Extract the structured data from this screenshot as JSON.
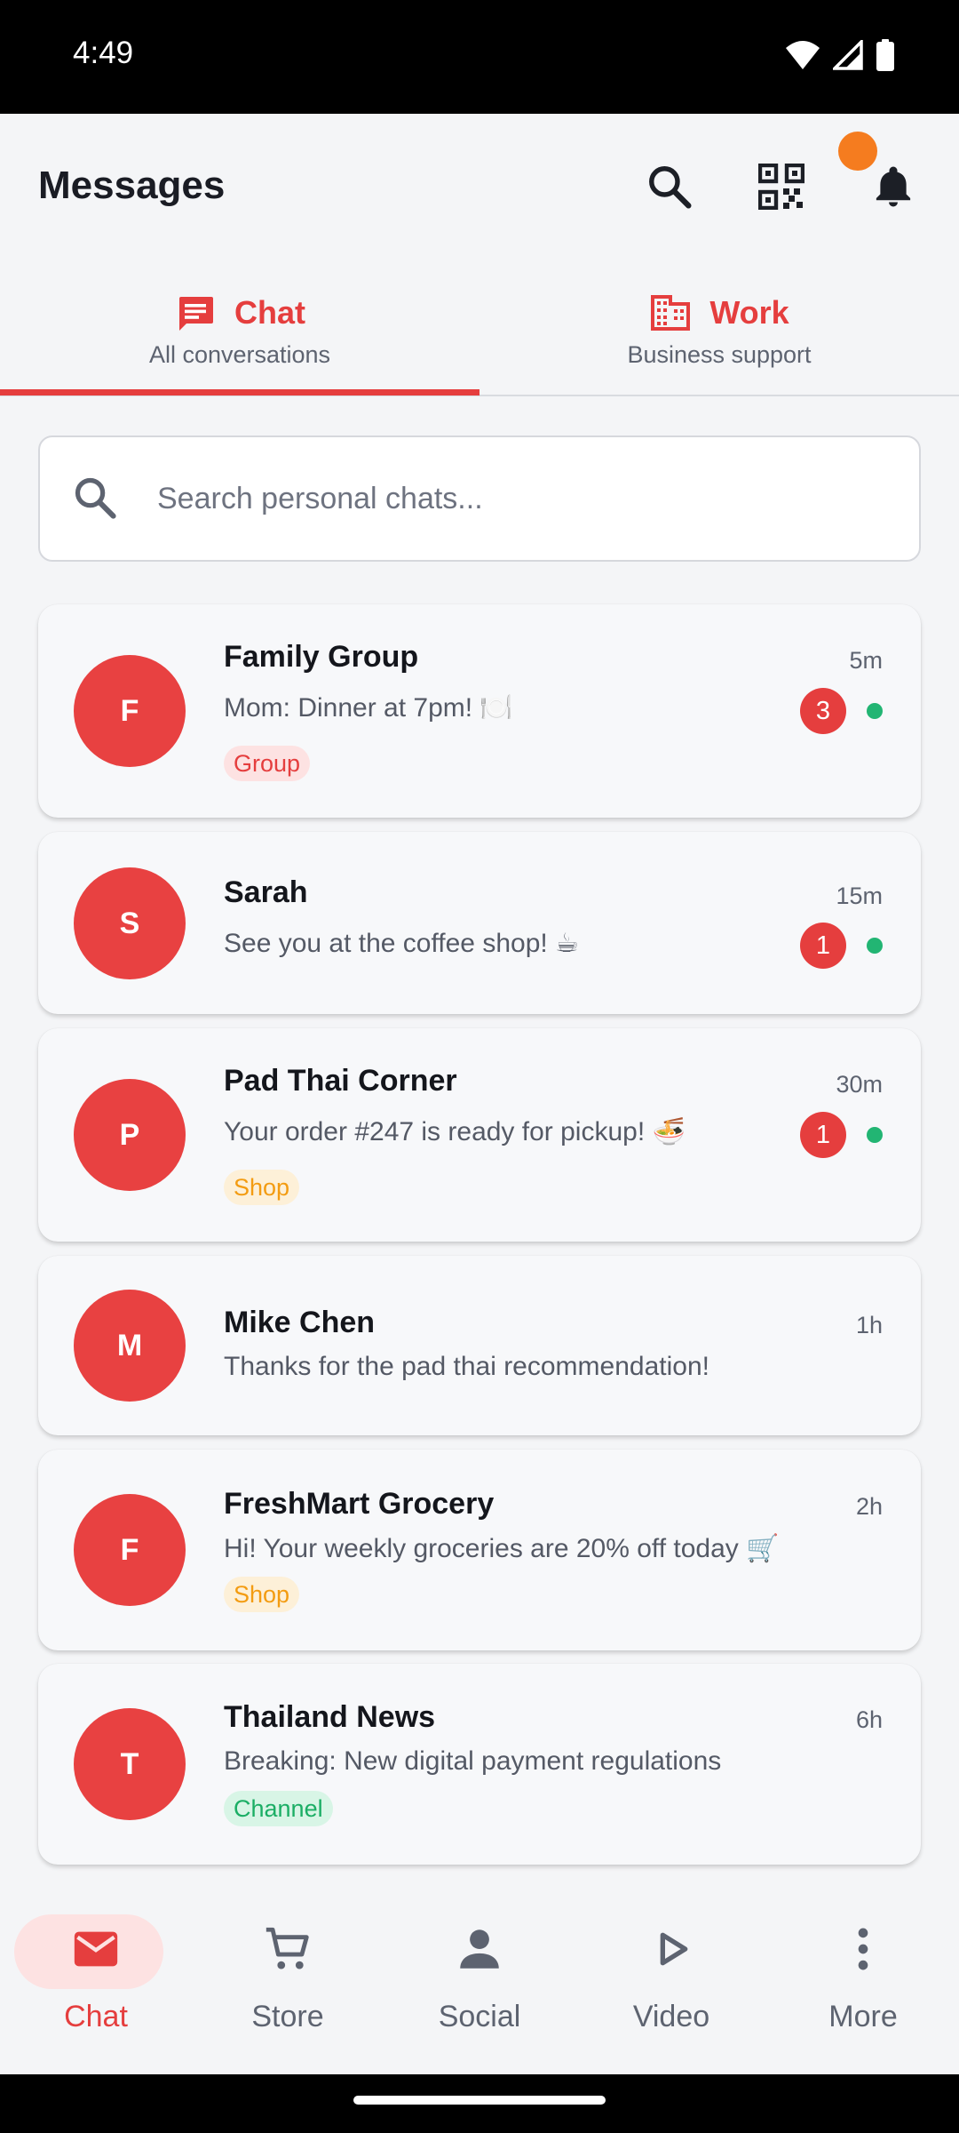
{
  "status_bar": {
    "time": "4:49"
  },
  "header": {
    "title": "Messages"
  },
  "tabs": [
    {
      "label": "Chat",
      "sub": "All conversations",
      "icon": "chat-icon"
    },
    {
      "label": "Work",
      "sub": "Business support",
      "icon": "building-icon"
    }
  ],
  "search": {
    "placeholder": "Search personal chats..."
  },
  "chats": [
    {
      "initial": "F",
      "name": "Family Group",
      "time": "5m",
      "message": "Mom: Dinner at 7pm! 🍽️",
      "unread": "3",
      "online": true,
      "tag": "Group"
    },
    {
      "initial": "S",
      "name": "Sarah",
      "time": "15m",
      "message": "See you at the coffee shop! ☕",
      "unread": "1",
      "online": true,
      "tag": ""
    },
    {
      "initial": "P",
      "name": "Pad Thai Corner",
      "time": "30m",
      "message": "Your order #247 is ready for pickup! 🍜",
      "unread": "1",
      "online": true,
      "tag": "Shop"
    },
    {
      "initial": "M",
      "name": "Mike Chen",
      "time": "1h",
      "message": "Thanks for the pad thai recommendation!",
      "unread": "",
      "online": false,
      "tag": ""
    },
    {
      "initial": "F",
      "name": "FreshMart Grocery",
      "time": "2h",
      "message": "Hi! Your weekly groceries are 20% off today 🛒",
      "unread": "",
      "online": false,
      "tag": "Shop"
    },
    {
      "initial": "T",
      "name": "Thailand News",
      "time": "6h",
      "message": "Breaking: New digital payment regulations",
      "unread": "",
      "online": false,
      "tag": "Channel"
    }
  ],
  "bottom_nav": [
    {
      "label": "Chat",
      "icon": "mail-icon",
      "active": true
    },
    {
      "label": "Store",
      "icon": "cart-icon",
      "active": false
    },
    {
      "label": "Social",
      "icon": "person-icon",
      "active": false
    },
    {
      "label": "Video",
      "icon": "play-icon",
      "active": false
    },
    {
      "label": "More",
      "icon": "more-vertical-icon",
      "active": false
    }
  ],
  "colors": {
    "accent": "#e53e3e",
    "online": "#22b573",
    "notification": "#f57c1f"
  }
}
